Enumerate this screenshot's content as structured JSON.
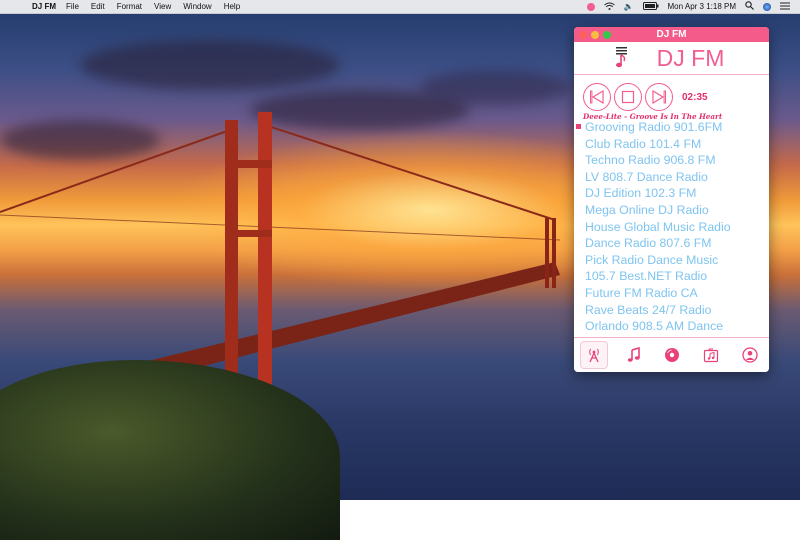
{
  "menubar": {
    "app_name": "DJ FM",
    "menus": [
      "File",
      "Edit",
      "Format",
      "View",
      "Window",
      "Help"
    ],
    "clock": "Mon Apr 3  1:18 PM"
  },
  "window": {
    "title": "DJ FM",
    "header_title": "DJ FM",
    "elapsed": "02:35",
    "now_playing": "Deee-Lite - Groove Is In The Heart",
    "stations": [
      "Grooving Radio 901.6FM",
      "Club Radio 101.4 FM",
      "Techno Radio 906.8 FM",
      "LV 808.7 Dance Radio",
      "DJ Edition 102.3 FM",
      "Mega Online DJ Radio",
      "House Global Music Radio",
      "Dance Radio 807.6 FM",
      "Pick Radio Dance Music",
      "105.7 Best.NET Radio",
      "Future FM Radio CA",
      "Rave Beats 24/7 Radio",
      "Orlando 908.5 AM Dance"
    ],
    "active_station_index": 0,
    "tabs": [
      {
        "icon": "radio-tower-icon",
        "selected": true
      },
      {
        "icon": "music-note-icon",
        "selected": false
      },
      {
        "icon": "vinyl-disc-icon",
        "selected": false
      },
      {
        "icon": "music-folder-icon",
        "selected": false
      },
      {
        "icon": "user-icon",
        "selected": false
      }
    ],
    "colors": {
      "accent": "#f25d92",
      "station_text": "#7ec4f0",
      "titlebar": "#f45a8a"
    }
  }
}
